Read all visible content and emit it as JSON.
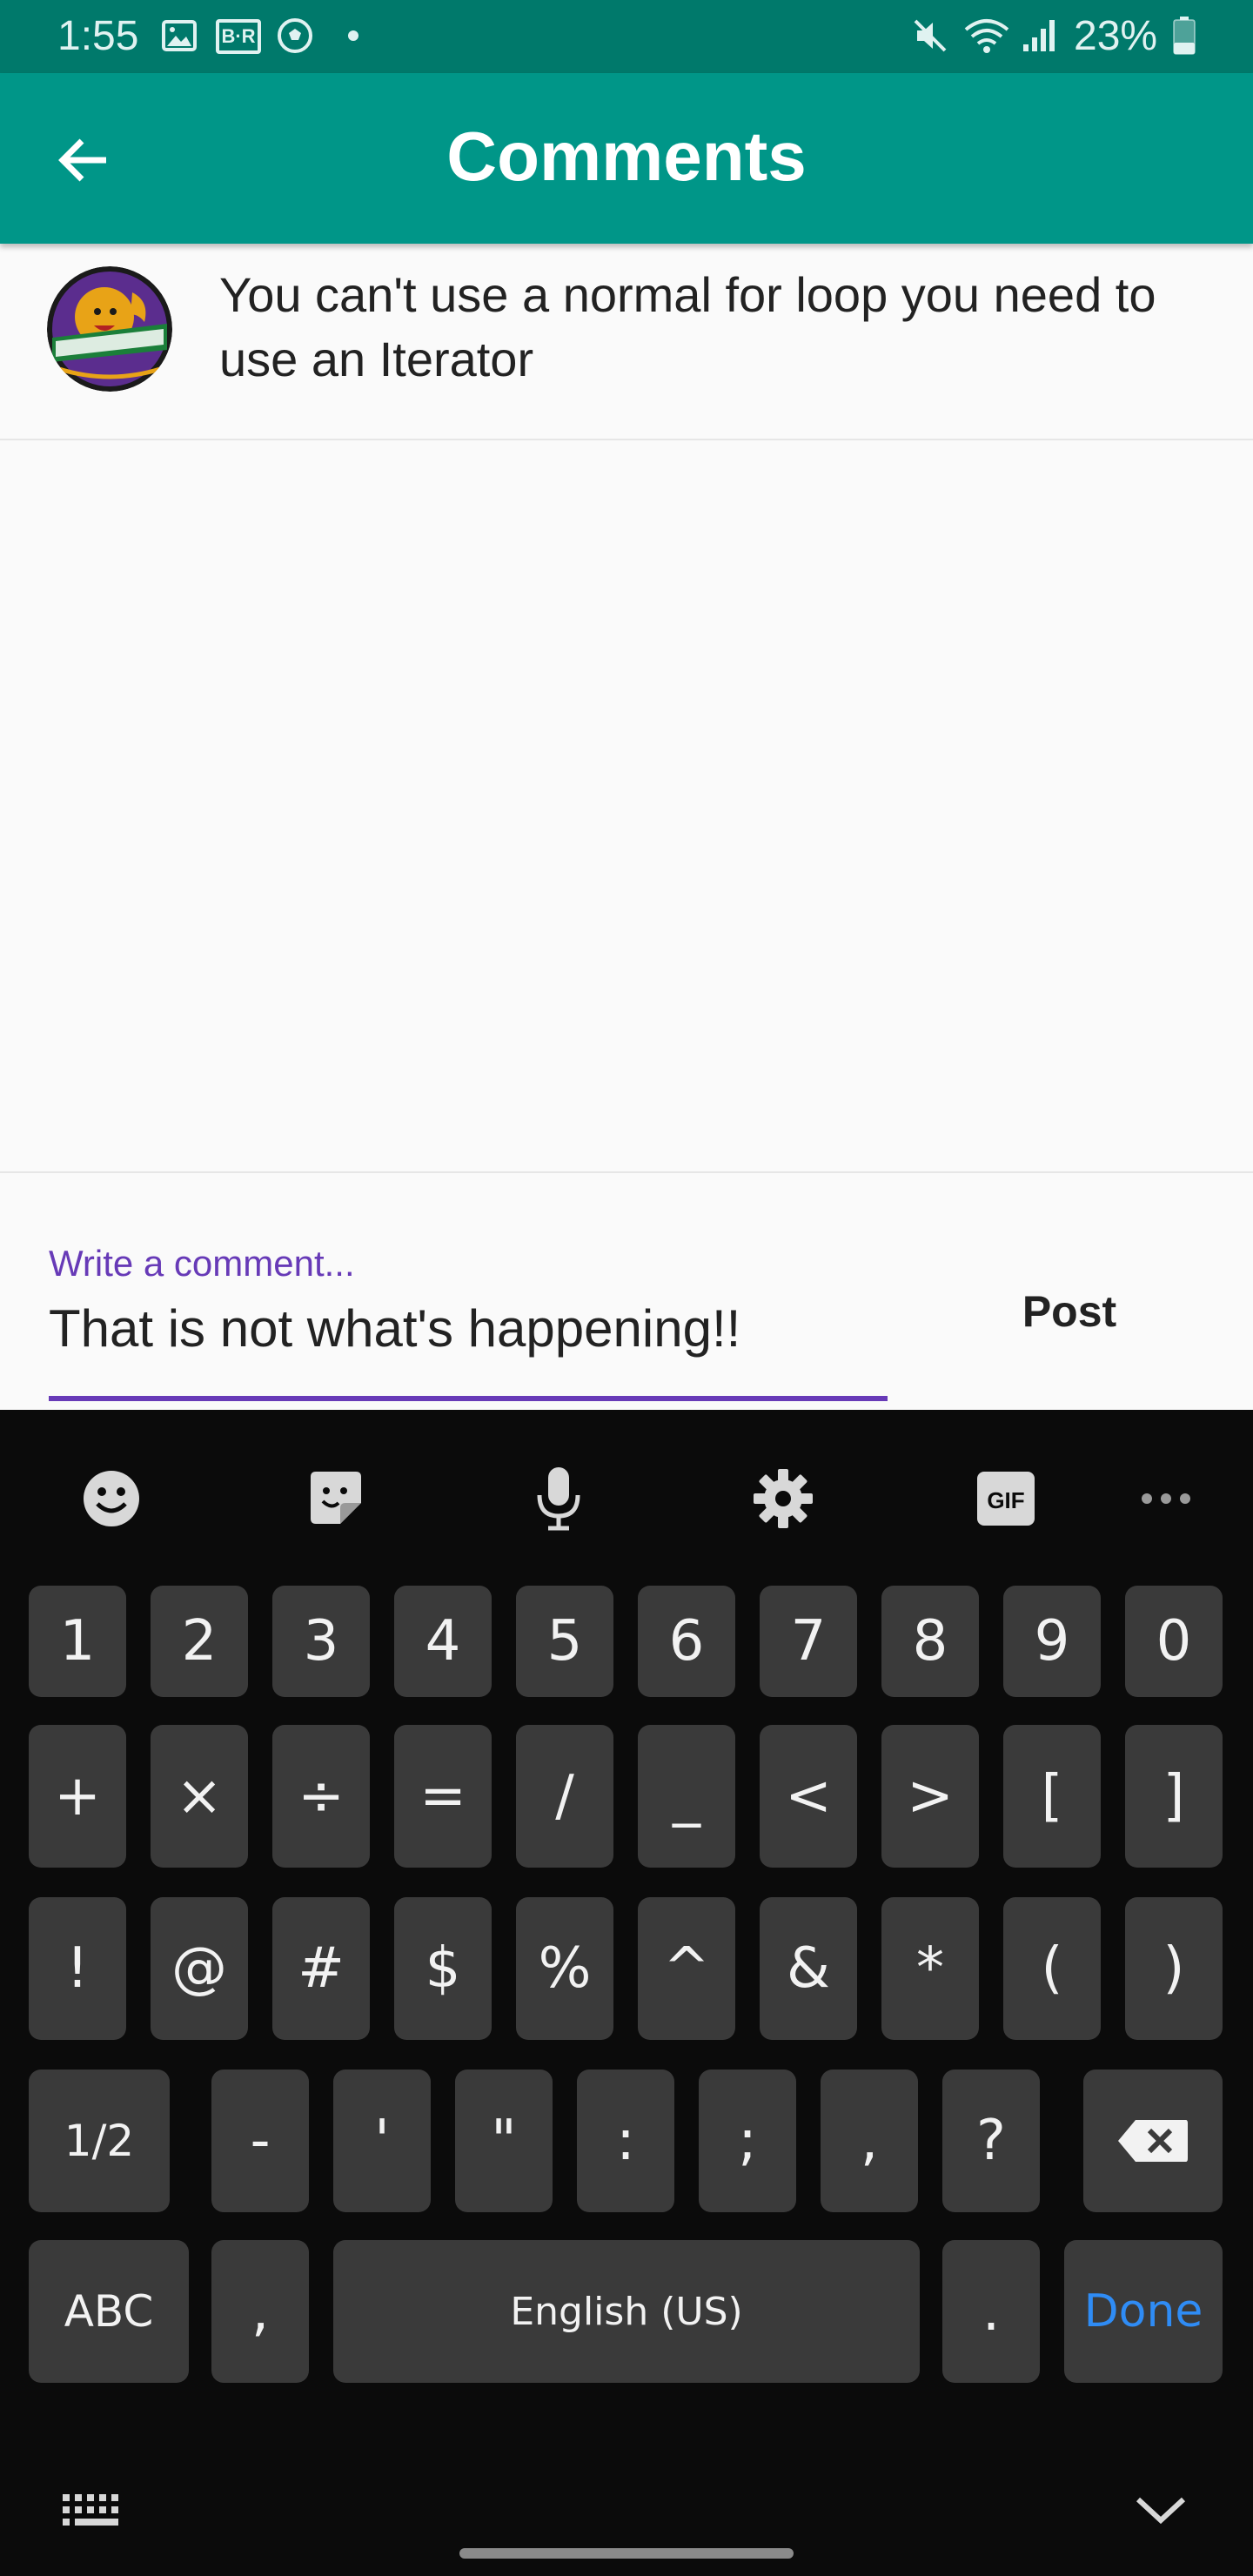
{
  "status_bar": {
    "time": "1:55",
    "br_badge": "B·R",
    "battery": "23%",
    "icons": [
      "gallery-icon",
      "br-icon",
      "soccer-ball-icon",
      "dot-icon",
      "mute-icon",
      "wifi-icon",
      "signal-icon",
      "battery-icon"
    ]
  },
  "app_bar": {
    "title": "Comments",
    "back_icon": "arrow-left-icon",
    "color": "#009688"
  },
  "comments": [
    {
      "avatar": "southeastern-lions-logo",
      "text": "You can't use a normal for loop you need to use an Iterator"
    }
  ],
  "comment_input": {
    "label": "Write a comment...",
    "value": "That is not what's happening!!",
    "accent": "#673ab7"
  },
  "post_button": {
    "label": "Post"
  },
  "keyboard": {
    "toolbar": [
      "emoji-icon",
      "sticker-icon",
      "microphone-icon",
      "settings-icon",
      "gif-icon",
      "more-icon"
    ],
    "gif_label": "GIF",
    "rows": [
      [
        "1",
        "2",
        "3",
        "4",
        "5",
        "6",
        "7",
        "8",
        "9",
        "0"
      ],
      [
        "+",
        "×",
        "÷",
        "=",
        "/",
        "_",
        "<",
        ">",
        "[",
        "]"
      ],
      [
        "!",
        "@",
        "#",
        "$",
        "%",
        "^",
        "&",
        "*",
        "(",
        ")"
      ],
      [
        "1/2",
        "-",
        "'",
        "\"",
        ":",
        ";",
        ",",
        "?"
      ],
      [
        "ABC",
        ",",
        "English (US)",
        ".",
        "Done"
      ]
    ],
    "backspace_icon": "backspace-icon",
    "hide_icon": "chevron-down-icon",
    "keyboard_switch_icon": "keyboard-icon"
  }
}
